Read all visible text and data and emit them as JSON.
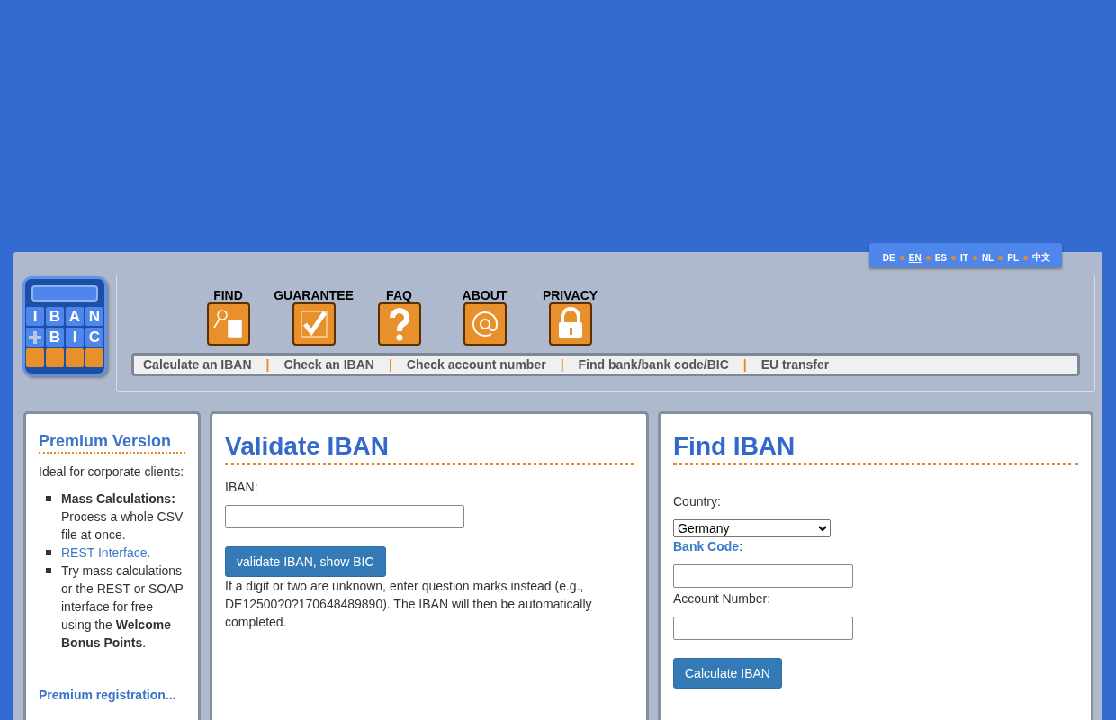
{
  "languages": [
    {
      "label": "DE",
      "selected": false
    },
    {
      "label": "EN",
      "selected": true
    },
    {
      "label": "ES",
      "selected": false
    },
    {
      "label": "IT",
      "selected": false
    },
    {
      "label": "NL",
      "selected": false
    },
    {
      "label": "PL",
      "selected": false
    },
    {
      "label": "中文",
      "selected": false
    }
  ],
  "logo": {
    "row_1": [
      "I",
      "B",
      "A",
      "N"
    ],
    "row_2": [
      "B",
      "I",
      "C"
    ]
  },
  "nav_icons": [
    {
      "label": "FIND",
      "kind": "find"
    },
    {
      "label": "GUARANTEE",
      "kind": "check"
    },
    {
      "label": "FAQ",
      "kind": "question"
    },
    {
      "label": "ABOUT",
      "kind": "at"
    },
    {
      "label": "PRIVACY",
      "kind": "lock"
    }
  ],
  "menu": [
    "Calculate an IBAN",
    "Check an IBAN",
    "Check account number",
    "Find bank/bank code/BIC",
    "EU transfer"
  ],
  "menu_separator": "|",
  "premium": {
    "title": "Premium Version",
    "intro": "Ideal for corporate clients:",
    "items": [
      {
        "kind": "text",
        "text": "**Mass Calculations:** Process a whole CSV file at once."
      },
      {
        "kind": "link",
        "text": "REST Interface."
      },
      {
        "kind": "text",
        "text": "Try mass calculations or the REST or SOAP interface for free using the **Welcome Bonus Points**."
      }
    ],
    "registration": "Premium registration..."
  },
  "validate": {
    "title": "Validate IBAN",
    "label": "IBAN:",
    "button": "validate IBAN, show BIC",
    "hint": "If a digit or two are unknown, enter question marks instead (e.g., DE12500?0?170648489890). The IBAN will then be automatically completed."
  },
  "find": {
    "title": "Find IBAN",
    "country_label": "Country:",
    "country": "Germany",
    "bank_code_label": "Bank Code",
    "bank_code_suffix": ":",
    "account_label": "Account Number:",
    "button": "Calculate IBAN"
  }
}
